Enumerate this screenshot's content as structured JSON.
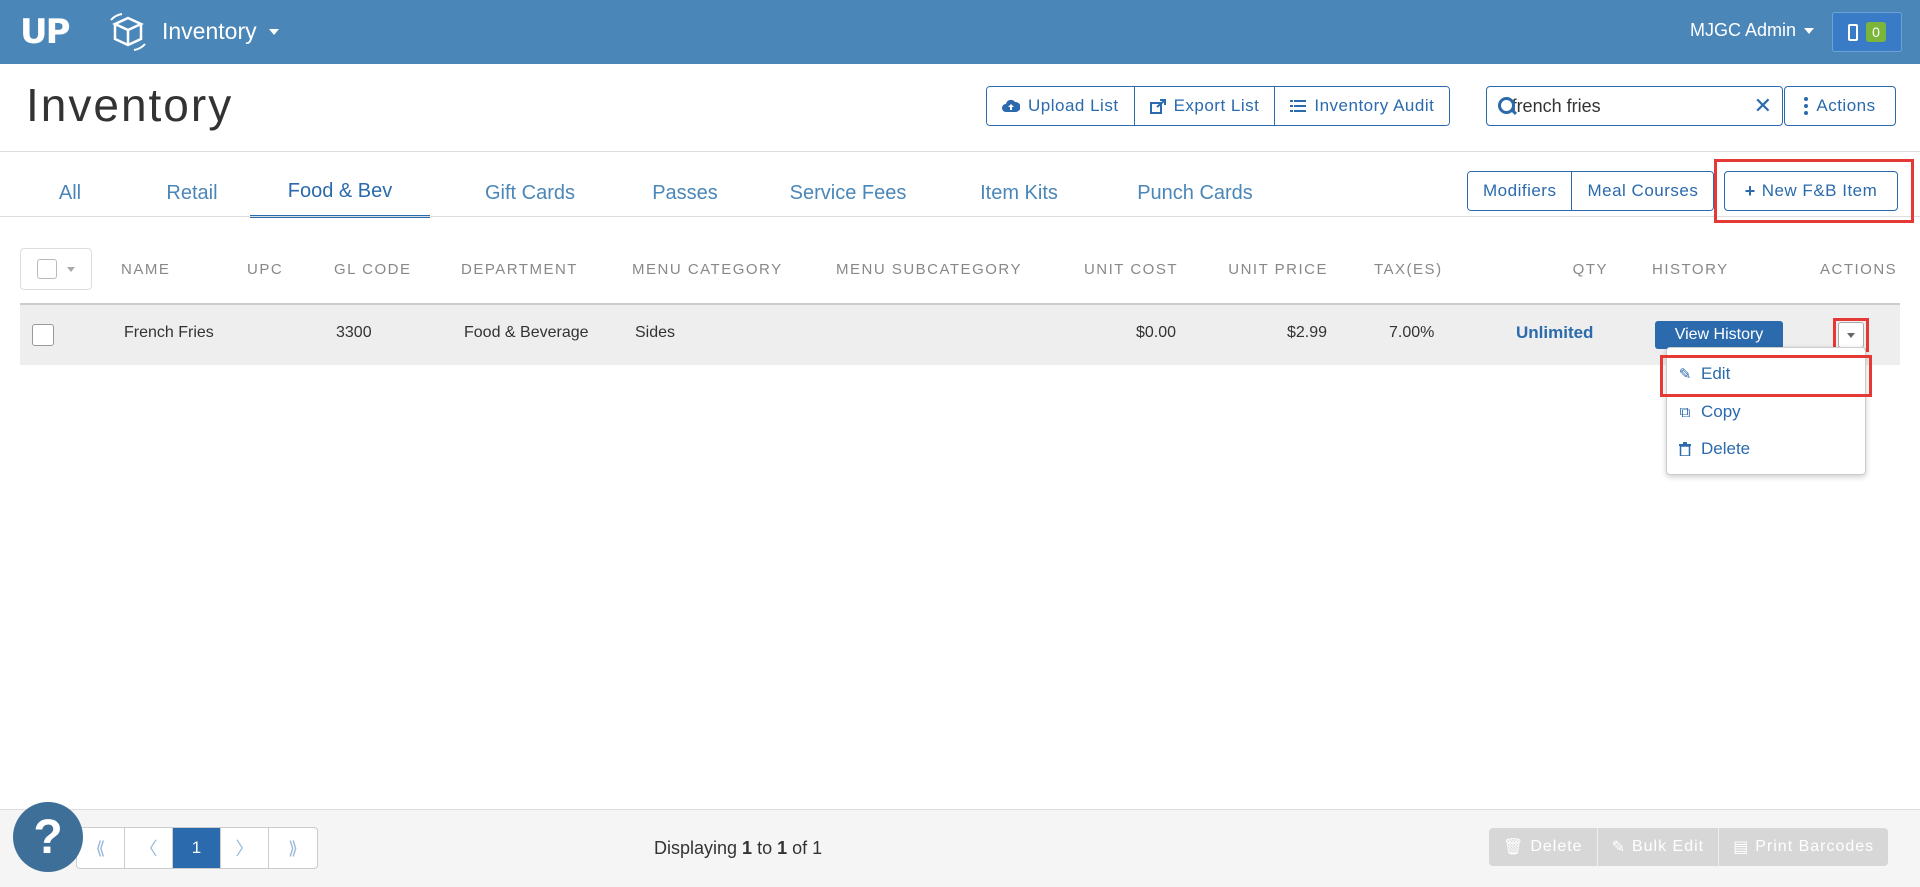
{
  "navbar": {
    "logo_text": "UP",
    "app_title": "Inventory",
    "user": "MJGC Admin",
    "notification_count": "0"
  },
  "page": {
    "title": "Inventory",
    "buttons": {
      "upload": "Upload List",
      "export": "Export List",
      "audit": "Inventory Audit",
      "actions": "Actions"
    },
    "search": {
      "value": "french fries",
      "placeholder": ""
    }
  },
  "tabs": [
    {
      "label": "All"
    },
    {
      "label": "Retail"
    },
    {
      "label": "Food & Bev",
      "active": true
    },
    {
      "label": "Gift Cards"
    },
    {
      "label": "Passes"
    },
    {
      "label": "Service Fees"
    },
    {
      "label": "Item Kits"
    },
    {
      "label": "Punch Cards"
    }
  ],
  "sub_buttons": {
    "modifiers": "Modifiers",
    "meal_courses": "Meal Courses",
    "new_item": "New F&B Item"
  },
  "table": {
    "headers": {
      "name": "NAME",
      "upc": "UPC",
      "gl_code": "GL CODE",
      "department": "DEPARTMENT",
      "menu_category": "MENU CATEGORY",
      "menu_subcategory": "MENU SUBCATEGORY",
      "unit_cost": "UNIT COST",
      "unit_price": "UNIT PRICE",
      "taxes": "TAX(ES)",
      "qty": "QTY",
      "history": "HISTORY",
      "actions": "ACTIONS"
    },
    "rows": [
      {
        "name": "French Fries",
        "upc": "",
        "gl_code": "3300",
        "department": "Food & Beverage",
        "menu_category": "Sides",
        "menu_subcategory": "",
        "unit_cost": "$0.00",
        "unit_price": "$2.99",
        "taxes": "7.00%",
        "qty": "Unlimited",
        "history_button": "View History"
      }
    ]
  },
  "row_menu": {
    "edit": "Edit",
    "copy": "Copy",
    "delete": "Delete"
  },
  "footer": {
    "pager": {
      "first": "⟪",
      "prev": "〈",
      "current": "1",
      "next": "〉",
      "last": "⟫"
    },
    "display_prefix": "Displaying ",
    "display_from": "1",
    "display_mid": " to ",
    "display_to": "1",
    "display_of": " of ",
    "display_total": "1",
    "buttons": {
      "delete": "Delete",
      "bulk_edit": "Bulk Edit",
      "print_barcodes": "Print Barcodes"
    }
  },
  "colors": {
    "navbar": "#4a86b8",
    "primary": "#2a6aad",
    "highlight": "#e53935",
    "badge": "#7bb63a"
  }
}
